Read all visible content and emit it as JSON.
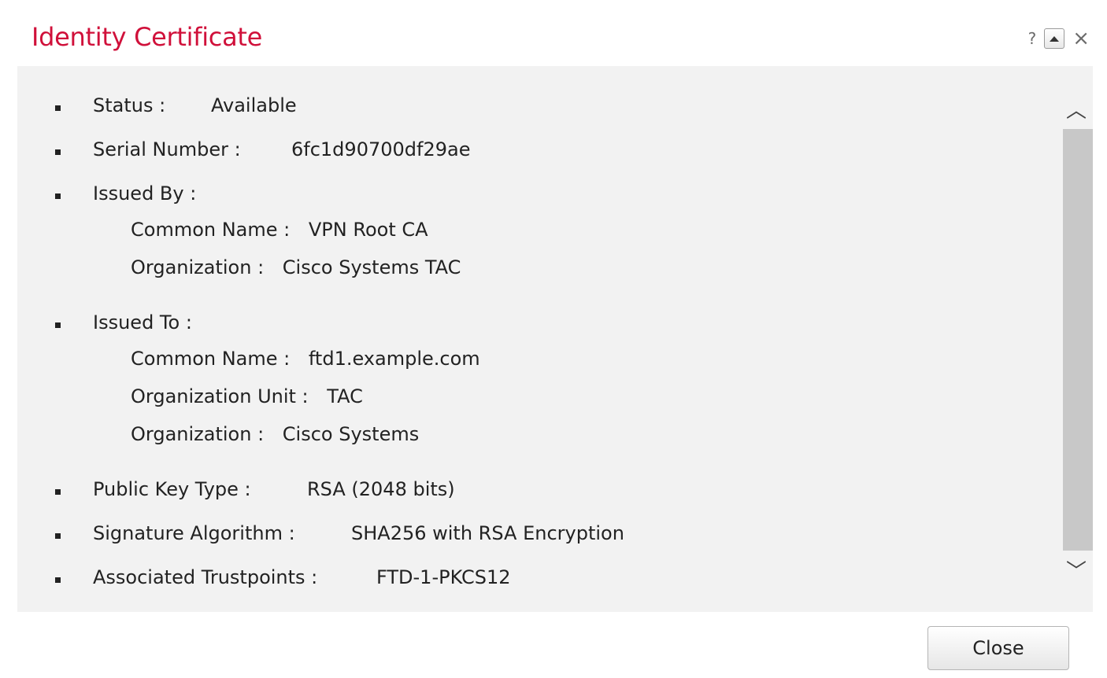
{
  "dialog": {
    "title": "Identity Certificate",
    "help_label": "?",
    "close_x": "×"
  },
  "certificate": {
    "status": {
      "label": "Status :",
      "value": "Available"
    },
    "serial": {
      "label": "Serial Number :",
      "value": "6fc1d90700df29ae"
    },
    "issued_by": {
      "label": "Issued By :",
      "common_name": {
        "label": "Common Name :",
        "value": "VPN Root CA"
      },
      "organization": {
        "label": "Organization :",
        "value": "Cisco Systems TAC"
      }
    },
    "issued_to": {
      "label": "Issued To :",
      "common_name": {
        "label": "Common Name :",
        "value": "ftd1.example.com"
      },
      "organization_unit": {
        "label": "Organization Unit :",
        "value": "TAC"
      },
      "organization": {
        "label": "Organization :",
        "value": "Cisco Systems"
      }
    },
    "public_key_type": {
      "label": "Public Key Type :",
      "value": "RSA (2048 bits)"
    },
    "signature_algorithm": {
      "label": "Signature Algorithm :",
      "value": "SHA256 with RSA Encryption"
    },
    "associated_trustpoints": {
      "label": "Associated Trustpoints :",
      "value": "FTD-1-PKCS12"
    }
  },
  "footer": {
    "close_label": "Close"
  },
  "colors": {
    "title": "#d0103a",
    "panel_bg": "#f2f2f2",
    "scrollbar": "#c8c8c8"
  },
  "icons": [
    "help-icon",
    "minimize-icon",
    "close-icon",
    "scroll-up-icon",
    "scroll-down-icon"
  ]
}
